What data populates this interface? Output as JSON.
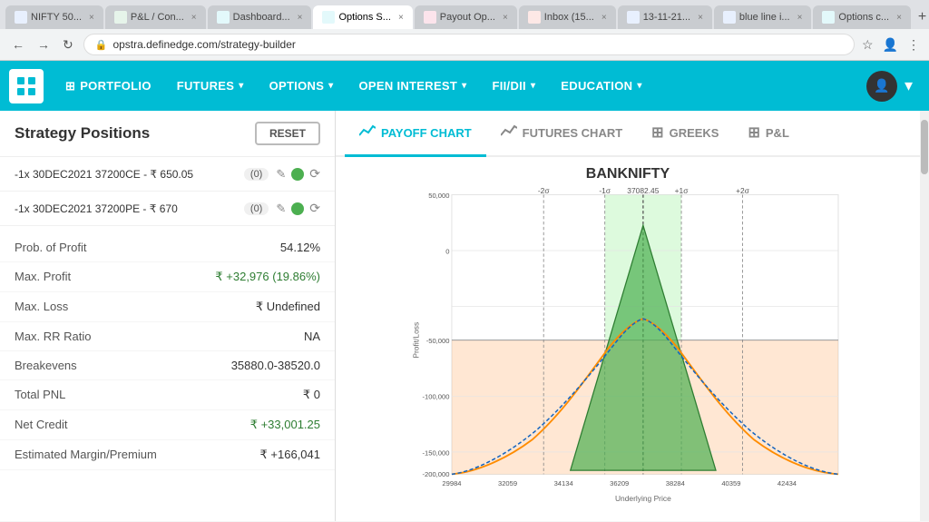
{
  "browser": {
    "tabs": [
      {
        "label": "NIFTY 50...",
        "active": false,
        "color": "#4285f4"
      },
      {
        "label": "P&L / Con...",
        "active": false,
        "color": "#34a853"
      },
      {
        "label": "Dashboard...",
        "active": false,
        "color": "#00bcd4"
      },
      {
        "label": "Options S...",
        "active": true,
        "color": "#00bcd4"
      },
      {
        "label": "Payout Op...",
        "active": false,
        "color": "#e91e63"
      },
      {
        "label": "Inbox (15...",
        "active": false,
        "color": "#ea4335"
      },
      {
        "label": "13-11-21...",
        "active": false,
        "color": "#4285f4"
      },
      {
        "label": "blue line i...",
        "active": false,
        "color": "#4285f4"
      },
      {
        "label": "Options c...",
        "active": false,
        "color": "#00bcd4"
      }
    ],
    "url": "opstra.definedge.com/strategy-builder"
  },
  "nav": {
    "portfolio": "PORTFOLIO",
    "futures": "FUTURES",
    "options": "OPTIONS",
    "open_interest": "OPEN INTEREST",
    "fii_dii": "FII/DII",
    "education": "EDUCATION"
  },
  "sidebar": {
    "title": "Strategy Positions",
    "reset_label": "RESET",
    "positions": [
      {
        "text": "-1x 30DEC2021 37200CE - ₹ 650.05",
        "badge": "(0)",
        "has_dot": true
      },
      {
        "text": "-1x 30DEC2021 37200PE - ₹ 670",
        "badge": "(0)",
        "has_dot": true
      }
    ],
    "stats": [
      {
        "label": "Prob. of Profit",
        "value": "54.12%"
      },
      {
        "label": "Max. Profit",
        "value": "₹ +32,976 (19.86%)"
      },
      {
        "label": "Max. Loss",
        "value": "₹ Undefined"
      },
      {
        "label": "Max. RR Ratio",
        "value": "NA"
      },
      {
        "label": "Breakevens",
        "value": "35880.0-38520.0"
      },
      {
        "label": "Total PNL",
        "value": "₹ 0"
      },
      {
        "label": "Net Credit",
        "value": "₹ +33,001.25"
      },
      {
        "label": "Estimated Margin/Premium",
        "value": "₹ +166,041"
      }
    ]
  },
  "chart": {
    "tabs": [
      {
        "label": "PAYOFF CHART",
        "active": true,
        "icon": "📈"
      },
      {
        "label": "FUTURES CHART",
        "active": false,
        "icon": "📈"
      },
      {
        "label": "GREEKS",
        "active": false,
        "icon": "⊞"
      },
      {
        "label": "P&L",
        "active": false,
        "icon": "⊞"
      }
    ],
    "title": "BANKNIFTY",
    "sigma_labels": [
      "-2σ",
      "-1σ",
      "37082.45",
      "+1σ",
      "+2σ"
    ],
    "y_labels": [
      "50,000",
      "0",
      "-50,000",
      "-100,000",
      "-150,000",
      "-200,000"
    ],
    "x_labels": [
      "29984",
      "32059",
      "34134",
      "36209",
      "38284",
      "40359",
      "42434"
    ],
    "y_axis_title": "Profit/Loss",
    "x_axis_title": "Underlying Price"
  }
}
